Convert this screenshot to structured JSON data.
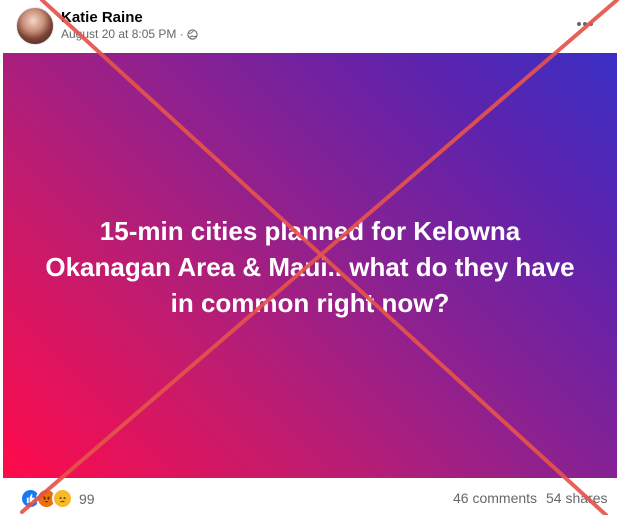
{
  "post": {
    "author": "Katie Raine",
    "timestamp": "August 20 at 8:05 PM ·",
    "privacy_icon": "globe-icon",
    "more_icon": "more-options-icon",
    "image_text_line1": "15-min cities planned for Kelowna",
    "image_text_line2": "Okanagan Area & Maui.. what do they have",
    "image_text_line3": "in common right now?",
    "image_gradient": [
      "#ff0a4a",
      "#8c2190",
      "#3a2fc4"
    ]
  },
  "footer": {
    "reaction_icons": [
      "like-icon",
      "angry-icon",
      "sad-icon"
    ],
    "reaction_count": "99",
    "comments": "46 comments",
    "shares": "54 shares"
  },
  "overlay": {
    "type": "red-x-mark",
    "color": "#e5534b"
  }
}
